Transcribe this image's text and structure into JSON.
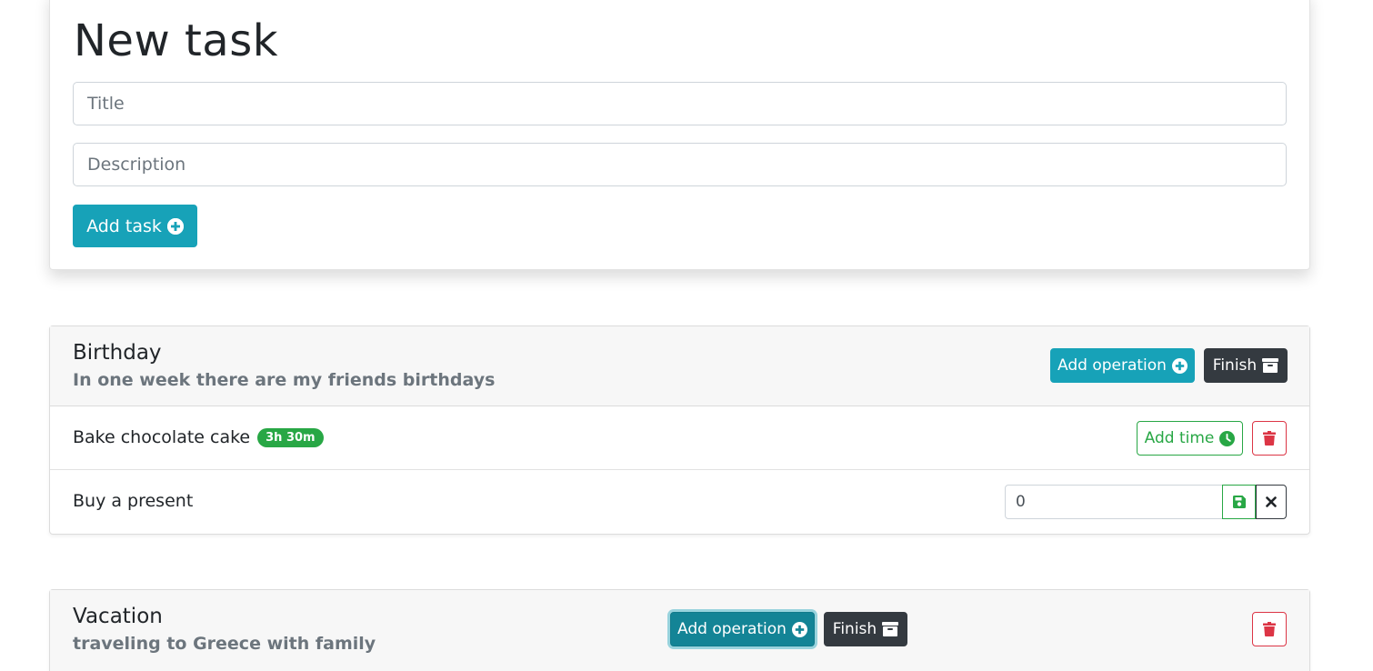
{
  "new_task": {
    "title": "New task",
    "title_placeholder": "Title",
    "description_placeholder": "Description",
    "add_button": "Add task"
  },
  "tasks": [
    {
      "title": "Birthday",
      "description": "In one week there are my friends birthdays",
      "add_operation_label": "Add operation",
      "finish_label": "Finish",
      "operations": [
        {
          "name": "Bake chocolate cake",
          "time_badge": "3h 30m",
          "add_time_label": "Add time"
        },
        {
          "name": "Buy a present",
          "time_input_value": "0"
        }
      ]
    },
    {
      "title": "Vacation",
      "description": "traveling to Greece with family",
      "add_operation_label": "Add operation",
      "finish_label": "Finish"
    }
  ],
  "colors": {
    "info": "#17a2b8",
    "dark": "#343a40",
    "success": "#28a745",
    "danger": "#dc3545"
  },
  "icons": [
    "plus-circle-icon",
    "archive-icon",
    "clock-icon",
    "trash-icon",
    "save-icon",
    "close-icon"
  ]
}
